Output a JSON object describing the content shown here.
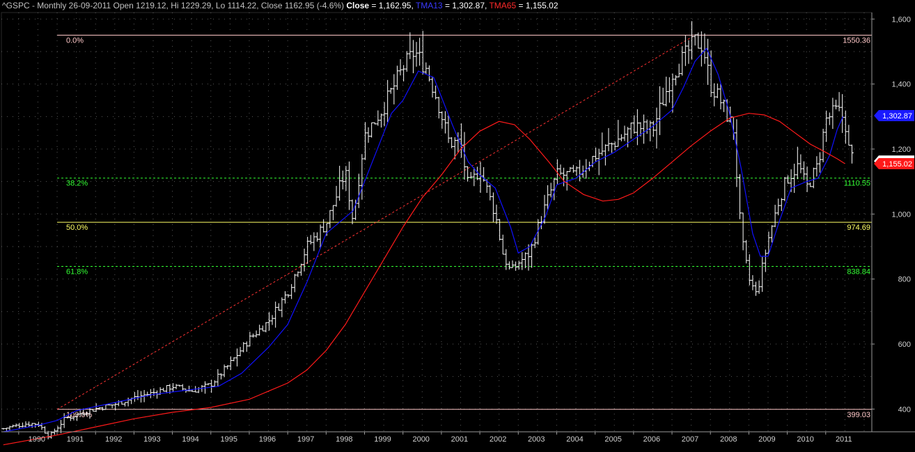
{
  "header": {
    "prefix": "^GSPC - Monthly 26-09-2011 Open 1219.12, Hi 1229.29, Lo 1114.22, Close 1162.95 (-4.6%)",
    "close_label": "Close",
    "close_value": " = 1,162.95, ",
    "tma13_label": "TMA13",
    "tma13_value": " = 1,302.87, ",
    "tma65_label": "TMA65",
    "tma65_value": " = 1,155.02"
  },
  "colors": {
    "background": "#000000",
    "grid": "#5a5a5a",
    "price": "#ffffff",
    "tma13": "#1010ff",
    "tma65": "#ff1a1a",
    "fib_0": "#ffc8c8",
    "fib_100": "#ffc8c8",
    "fib_382": "#33ff33",
    "fib_50": "#ffff66",
    "fib_618": "#33ff33",
    "trendline": "#ff3333"
  },
  "chart_data": {
    "type": "line",
    "ylim": [
      330,
      1620
    ],
    "xlim": [
      1989.55,
      2012.2
    ],
    "y_ticks": [
      400,
      600,
      800,
      1000,
      1200,
      1400,
      1600
    ],
    "y_tick_labels": [
      "400",
      "600",
      "800",
      "1,000",
      "1,200",
      "1,400",
      "1,600"
    ],
    "x_ticks": [
      1990,
      1991,
      1992,
      1993,
      1994,
      1995,
      1996,
      1997,
      1998,
      1999,
      2000,
      2001,
      2002,
      2003,
      2004,
      2005,
      2006,
      2007,
      2008,
      2009,
      2010,
      2011
    ],
    "x_tick_labels": [
      "1990",
      "1991",
      "1992",
      "1993",
      "1994",
      "1995",
      "1996",
      "1997",
      "1998",
      "1999",
      "2000",
      "2001",
      "2002",
      "2003",
      "2004",
      "2005",
      "2006",
      "2007",
      "2008",
      "2009",
      "2010",
      "2011"
    ],
    "grid": true,
    "price_anchors": {
      "t": [
        1989.6,
        1990.2,
        1990.5,
        1990.8,
        1991.2,
        1991.8,
        1992.5,
        1993.0,
        1993.5,
        1994.0,
        1994.5,
        1995.0,
        1995.5,
        1996.0,
        1996.5,
        1997.0,
        1997.5,
        1998.0,
        1998.5,
        1998.7,
        1999.0,
        1999.5,
        2000.0,
        2000.3,
        2000.6,
        2000.9,
        2001.2,
        2001.5,
        2001.7,
        2002.0,
        2002.4,
        2002.6,
        2002.8,
        2003.0,
        2003.3,
        2003.6,
        2004.0,
        2004.5,
        2005.0,
        2005.5,
        2006.0,
        2006.5,
        2007.0,
        2007.3,
        2007.6,
        2007.8,
        2008.0,
        2008.3,
        2008.6,
        2008.8,
        2009.0,
        2009.2,
        2009.5,
        2009.8,
        2010.0,
        2010.3,
        2010.5,
        2010.8,
        2011.0,
        2011.3,
        2011.5,
        2011.6,
        2011.72
      ],
      "v": [
        340,
        355,
        355,
        315,
        370,
        395,
        415,
        435,
        450,
        470,
        455,
        475,
        540,
        615,
        670,
        760,
        900,
        970,
        1130,
        980,
        1240,
        1330,
        1450,
        1500,
        1450,
        1350,
        1220,
        1220,
        1080,
        1140,
        1000,
        880,
        820,
        850,
        880,
        990,
        1120,
        1120,
        1180,
        1220,
        1270,
        1260,
        1430,
        1480,
        1530,
        1520,
        1400,
        1340,
        1260,
        930,
        800,
        750,
        920,
        1050,
        1110,
        1150,
        1080,
        1150,
        1290,
        1320,
        1290,
        1200,
        1163
      ]
    },
    "series": [
      {
        "name": "TMA13",
        "x": [
          1989.6,
          1990.5,
          1991.0,
          1991.5,
          1992.5,
          1993.5,
          1994.5,
          1995.2,
          1995.8,
          1996.5,
          1997.0,
          1997.5,
          1998.0,
          1998.7,
          1999.3,
          1999.7,
          2000.0,
          2000.4,
          2000.8,
          2001.3,
          2001.7,
          2002.0,
          2002.4,
          2002.8,
          2003.0,
          2003.3,
          2003.7,
          2004.0,
          2004.5,
          2005.0,
          2005.5,
          2006.0,
          2006.5,
          2007.0,
          2007.3,
          2007.6,
          2007.9,
          2008.2,
          2008.5,
          2008.8,
          2009.1,
          2009.3,
          2009.5,
          2009.8,
          2010.1,
          2010.5,
          2010.8,
          2011.1,
          2011.3,
          2011.45
        ],
        "y": [
          330,
          350,
          365,
          395,
          420,
          445,
          460,
          470,
          510,
          590,
          660,
          790,
          940,
          1010,
          1190,
          1310,
          1350,
          1440,
          1420,
          1270,
          1160,
          1120,
          1080,
          960,
          880,
          900,
          990,
          1090,
          1110,
          1160,
          1190,
          1230,
          1270,
          1320,
          1390,
          1470,
          1510,
          1430,
          1310,
          1140,
          940,
          870,
          870,
          980,
          1080,
          1100,
          1110,
          1180,
          1260,
          1300
        ]
      },
      {
        "name": "TMA65",
        "x": [
          1989.6,
          1991.0,
          1992.0,
          1993.0,
          1994.0,
          1995.0,
          1996.0,
          1997.0,
          1997.5,
          1998.0,
          1998.5,
          1999.0,
          1999.5,
          2000.0,
          2000.5,
          2001.0,
          2001.5,
          2002.0,
          2002.5,
          2002.9,
          2003.3,
          2003.8,
          2004.2,
          2004.7,
          2005.2,
          2005.6,
          2006.0,
          2006.5,
          2007.0,
          2007.5,
          2008.0,
          2008.5,
          2009.0,
          2009.4,
          2009.8,
          2010.2,
          2010.6,
          2011.0,
          2011.3,
          2011.5
        ],
        "y": [
          290,
          320,
          345,
          370,
          390,
          405,
          430,
          480,
          520,
          580,
          660,
          760,
          860,
          960,
          1050,
          1120,
          1200,
          1255,
          1285,
          1275,
          1230,
          1160,
          1100,
          1060,
          1040,
          1045,
          1065,
          1110,
          1160,
          1210,
          1255,
          1295,
          1310,
          1305,
          1285,
          1250,
          1215,
          1190,
          1170,
          1155
        ]
      }
    ],
    "last": {
      "close": 1162.95,
      "tma13": 1302.87,
      "tma65": 1155.02
    },
    "value_labels": {
      "close": "1,162.95",
      "tma13": "1,302.87",
      "tma65": "1,155.02"
    },
    "fib_levels": [
      {
        "pct": "0.0%",
        "value": 1550.36,
        "value_label": "1550.36"
      },
      {
        "pct": "38.2%",
        "value": 1110.55,
        "value_label": "1110.55"
      },
      {
        "pct": "50.0%",
        "value": 974.69,
        "value_label": "974.69"
      },
      {
        "pct": "61.8%",
        "value": 838.84,
        "value_label": "838.84"
      },
      {
        "pct": "100.0%",
        "value": 399.03,
        "value_label": "399.03"
      }
    ],
    "trendline": {
      "x": [
        1991.0,
        2007.6
      ],
      "y": [
        399.03,
        1550.36
      ]
    }
  }
}
